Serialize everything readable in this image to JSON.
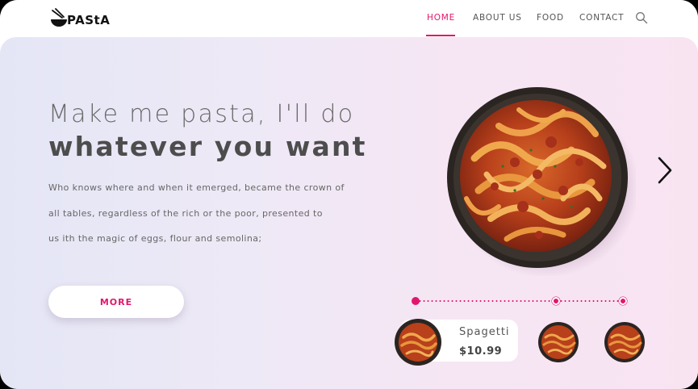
{
  "brand": {
    "logo_text": "PAStA"
  },
  "nav": {
    "items": [
      {
        "label": "HOME",
        "active": true
      },
      {
        "label": "ABOUT US",
        "active": false
      },
      {
        "label": "FOOD",
        "active": false
      },
      {
        "label": "CONTACT",
        "active": false
      }
    ],
    "search_icon": "search-icon"
  },
  "hero": {
    "headline_line1": "Make me pasta, I'll do",
    "headline_line2": "whatever you want",
    "body_lines": [
      "Who knows where and when it  emerged, became the crown of",
      "all  tables, regardless of the rich or the poor, presented to",
      "us ith the magic of eggs, flour and semolina;"
    ],
    "cta_label": "MORE",
    "next_icon": "chevron-right-icon"
  },
  "slider": {
    "dots": 3,
    "active_index": 0
  },
  "featured_product": {
    "name": "Spagetti",
    "price": "$10.99"
  },
  "colors": {
    "accent": "#e1176d",
    "text_dark": "#4d4d4d",
    "text_light": "#6b6b6b"
  }
}
